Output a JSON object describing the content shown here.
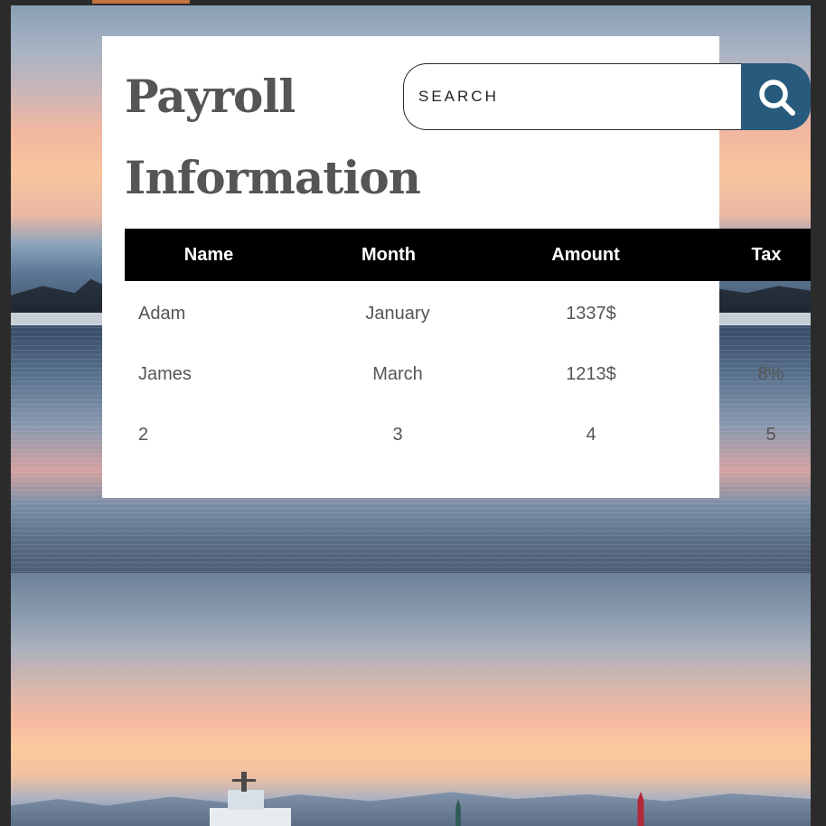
{
  "page": {
    "title_line1": "Payroll",
    "title_line2": "Information"
  },
  "search": {
    "placeholder": "SEARCH",
    "value": ""
  },
  "table": {
    "headers": [
      "Name",
      "Month",
      "Amount",
      "Tax"
    ],
    "rows": [
      [
        "Adam",
        "January",
        "1337$",
        ""
      ],
      [
        "James",
        "March",
        "1213$",
        "8%"
      ],
      [
        "2",
        "3",
        "4",
        "5"
      ]
    ]
  },
  "colors": {
    "accent": "#c5733f",
    "search_button": "#275a7c",
    "header_bg": "#000000",
    "card_bg": "#ffffff",
    "title_text": "#555555"
  },
  "icons": {
    "search": "search-icon"
  }
}
